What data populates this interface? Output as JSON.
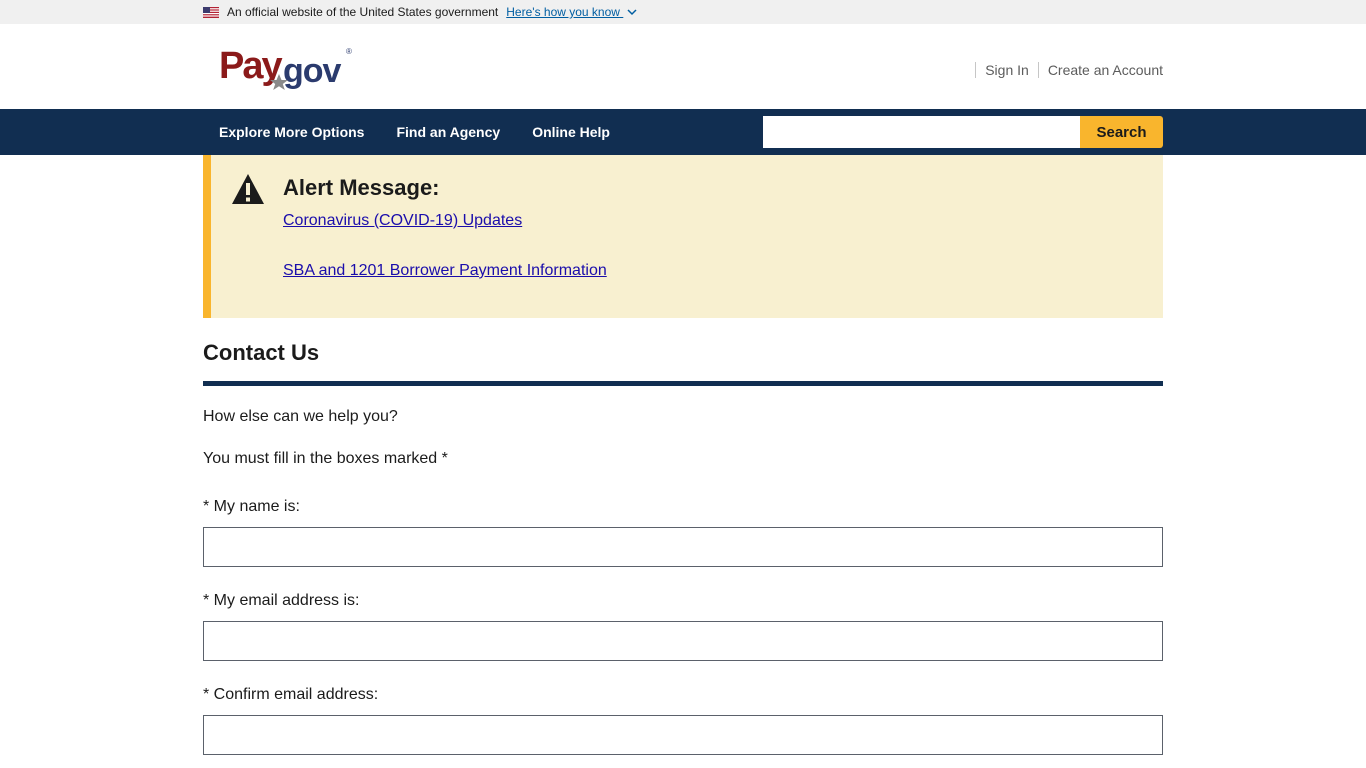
{
  "gov_banner": {
    "text": "An official website of the United States government",
    "link": "Here's how you know",
    "icons": {
      "flag": "us-flag-icon",
      "chevron": "chevron-down-icon"
    }
  },
  "header": {
    "logo_text": "Pay.gov",
    "sign_in": "Sign In",
    "create_account": "Create an Account"
  },
  "nav": {
    "items": [
      {
        "label": "Explore More Options"
      },
      {
        "label": "Find an Agency"
      },
      {
        "label": "Online Help"
      }
    ],
    "search": {
      "placeholder": "",
      "button_label": "Search"
    }
  },
  "alert": {
    "icon": "warning-icon",
    "title": "Alert Message:",
    "links": [
      {
        "label": "Coronavirus (COVID-19) Updates"
      },
      {
        "label": "SBA and 1201 Borrower Payment Information"
      }
    ]
  },
  "main": {
    "title": "Contact Us",
    "intro": "How else can we help you?",
    "required_note": "You must fill in the boxes marked *",
    "fields": [
      {
        "label": "* My name is:",
        "value": ""
      },
      {
        "label": "* My email address is:",
        "value": ""
      },
      {
        "label": "* Confirm email address:",
        "value": ""
      }
    ]
  },
  "colors": {
    "nav_bg": "#112e51",
    "accent_yellow": "#f9b52d",
    "alert_bg": "#f8f0d0",
    "link_blue": "#1a0dab"
  }
}
